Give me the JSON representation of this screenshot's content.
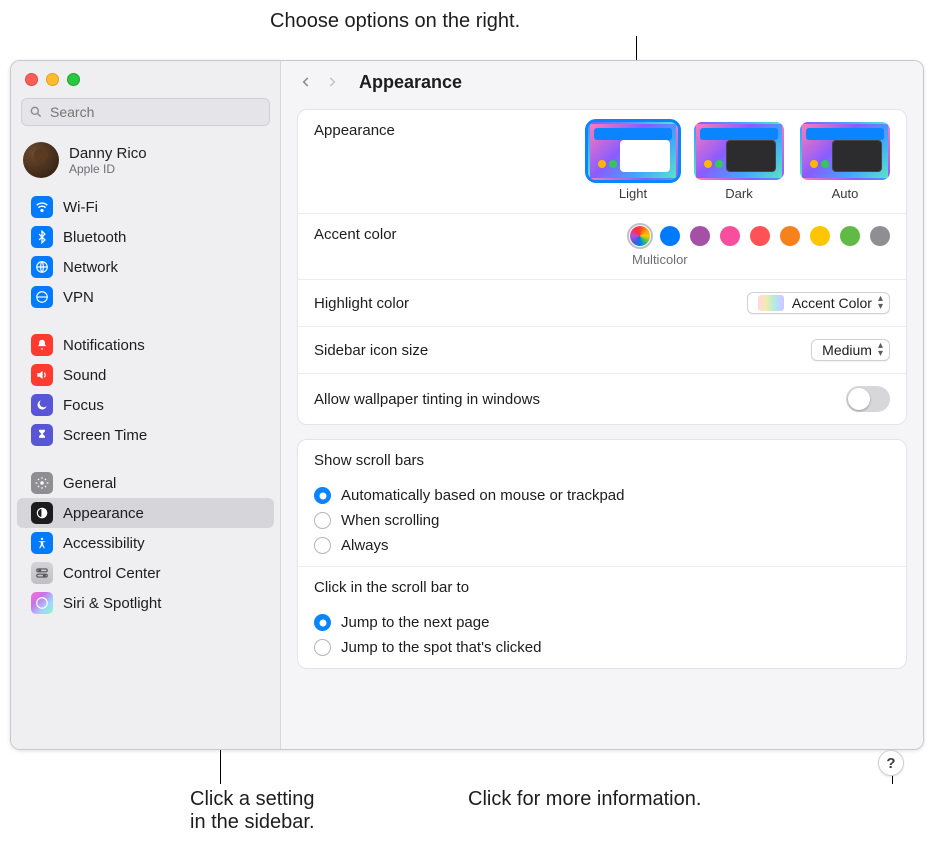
{
  "callouts": {
    "top": "Choose options on the right.",
    "bottom_left": "Click a setting\nin the sidebar.",
    "bottom_right": "Click for more information."
  },
  "window": {
    "title": "Appearance",
    "search_placeholder": "Search",
    "user": {
      "name": "Danny Rico",
      "sub": "Apple ID"
    }
  },
  "sidebar": {
    "groups": [
      [
        "Wi-Fi",
        "Bluetooth",
        "Network",
        "VPN"
      ],
      [
        "Notifications",
        "Sound",
        "Focus",
        "Screen Time"
      ],
      [
        "General",
        "Appearance",
        "Accessibility",
        "Control Center",
        "Siri & Spotlight"
      ]
    ]
  },
  "appearance": {
    "label": "Appearance",
    "options": [
      "Light",
      "Dark",
      "Auto"
    ],
    "selected": "Light"
  },
  "accent": {
    "label": "Accent color",
    "caption": "Multicolor",
    "colors": [
      "multi",
      "#007aff",
      "#a550a7",
      "#f74f9e",
      "#ff5257",
      "#f7821b",
      "#ffc600",
      "#62ba46",
      "#8e8e93"
    ]
  },
  "highlight": {
    "label": "Highlight color",
    "value": "Accent Color"
  },
  "sidebar_icon": {
    "label": "Sidebar icon size",
    "value": "Medium"
  },
  "tinting": {
    "label": "Allow wallpaper tinting in windows",
    "on": false
  },
  "scrollbars": {
    "label": "Show scroll bars",
    "options": [
      "Automatically based on mouse or trackpad",
      "When scrolling",
      "Always"
    ],
    "selected": 0
  },
  "scrollclick": {
    "label": "Click in the scroll bar to",
    "options": [
      "Jump to the next page",
      "Jump to the spot that's clicked"
    ],
    "selected": 0
  },
  "help_glyph": "?"
}
